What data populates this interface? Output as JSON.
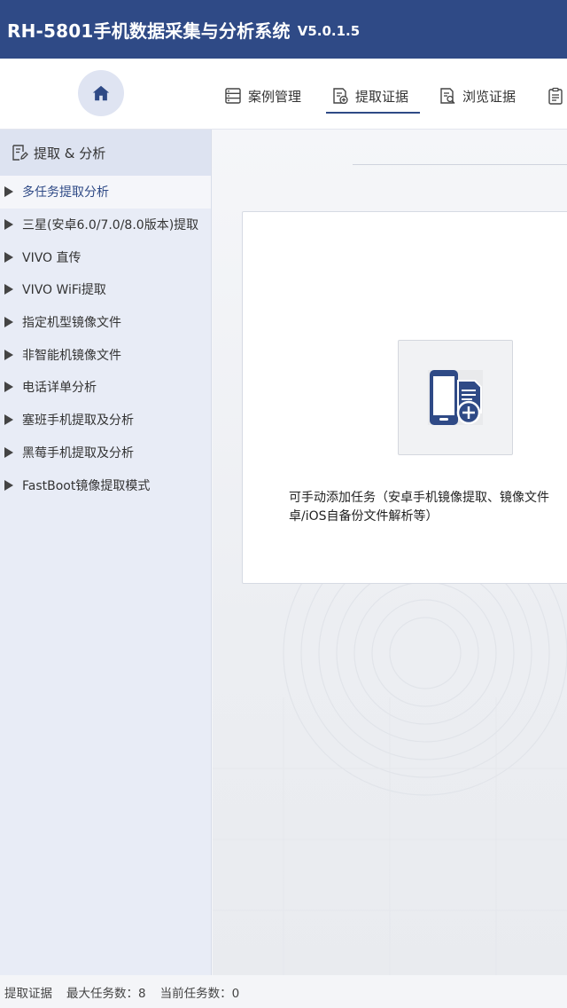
{
  "app": {
    "name": "RH-5801手机数据采集与分析系统",
    "version": "V5.0.1.5"
  },
  "topnav": {
    "items": [
      {
        "label": "案例管理",
        "icon": "case-list-icon"
      },
      {
        "label": "提取证据",
        "icon": "extract-evidence-icon",
        "active": true
      },
      {
        "label": "浏览证据",
        "icon": "browse-evidence-icon"
      },
      {
        "label": "",
        "icon": "clipboard-icon"
      }
    ],
    "home_icon": "home-icon",
    "accent": "#2f4a86"
  },
  "sidebar": {
    "header": "提取 & 分析",
    "items": [
      {
        "label": "多任务提取分析",
        "active": true
      },
      {
        "label": "三星(安卓6.0/7.0/8.0版本)提取"
      },
      {
        "label": "VIVO 直传"
      },
      {
        "label": "VIVO WiFi提取"
      },
      {
        "label": "指定机型镜像文件"
      },
      {
        "label": "非智能机镜像文件"
      },
      {
        "label": "电话详单分析"
      },
      {
        "label": "塞班手机提取及分析"
      },
      {
        "label": "黑莓手机提取及分析"
      },
      {
        "label": "FastBoot镜像提取模式"
      }
    ]
  },
  "main": {
    "add_task_icon": "phone-add-document-icon",
    "description_line1": "可手动添加任务（安卓手机镜像提取、镜像文件",
    "description_line2": "卓/iOS自备份文件解析等）"
  },
  "status": {
    "mode": "提取证据",
    "max_tasks": "最大任务数：8",
    "current_tasks": "当前任务数：0"
  }
}
